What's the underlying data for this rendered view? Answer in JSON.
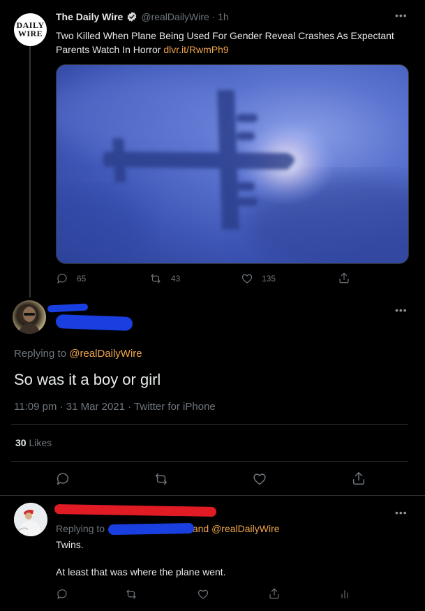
{
  "colors": {
    "background": "#000000",
    "link": "#f0a44b",
    "verified": "#d9d9d9",
    "divider": "#2f3336",
    "redact_blue": "#1a3fe0",
    "redact_red": "#e01b24"
  },
  "original_tweet": {
    "avatar_text": [
      "DAILY",
      "WIRE"
    ],
    "author_name": "The Daily Wire",
    "handle_time": "@realDailyWire · 1h",
    "more_icon": "more-horizontal-icon",
    "text": "Two Killed When Plane Being Used For Gender Reveal Crashes As Expectant Parents Watch In Horror",
    "link": "dlvr.it/RwmPh9",
    "image_description_icon": "airplane-shadow-in-clouds",
    "actions": {
      "replies": "65",
      "retweets": "43",
      "likes": "135"
    }
  },
  "main_tweet": {
    "replying_prefix": "Replying to",
    "replying_handle": "@realDailyWire",
    "text": "So was it a boy or girl",
    "meta": "11:09 pm · 31 Mar 2021 · Twitter for iPhone",
    "likes_count": "30",
    "likes_label": "Likes"
  },
  "reply_tweet": {
    "replying_prefix": "Replying to",
    "replying_suffix": "and @realDailyWire",
    "line1": "Twins.",
    "line2": "At least that was where the plane went."
  }
}
